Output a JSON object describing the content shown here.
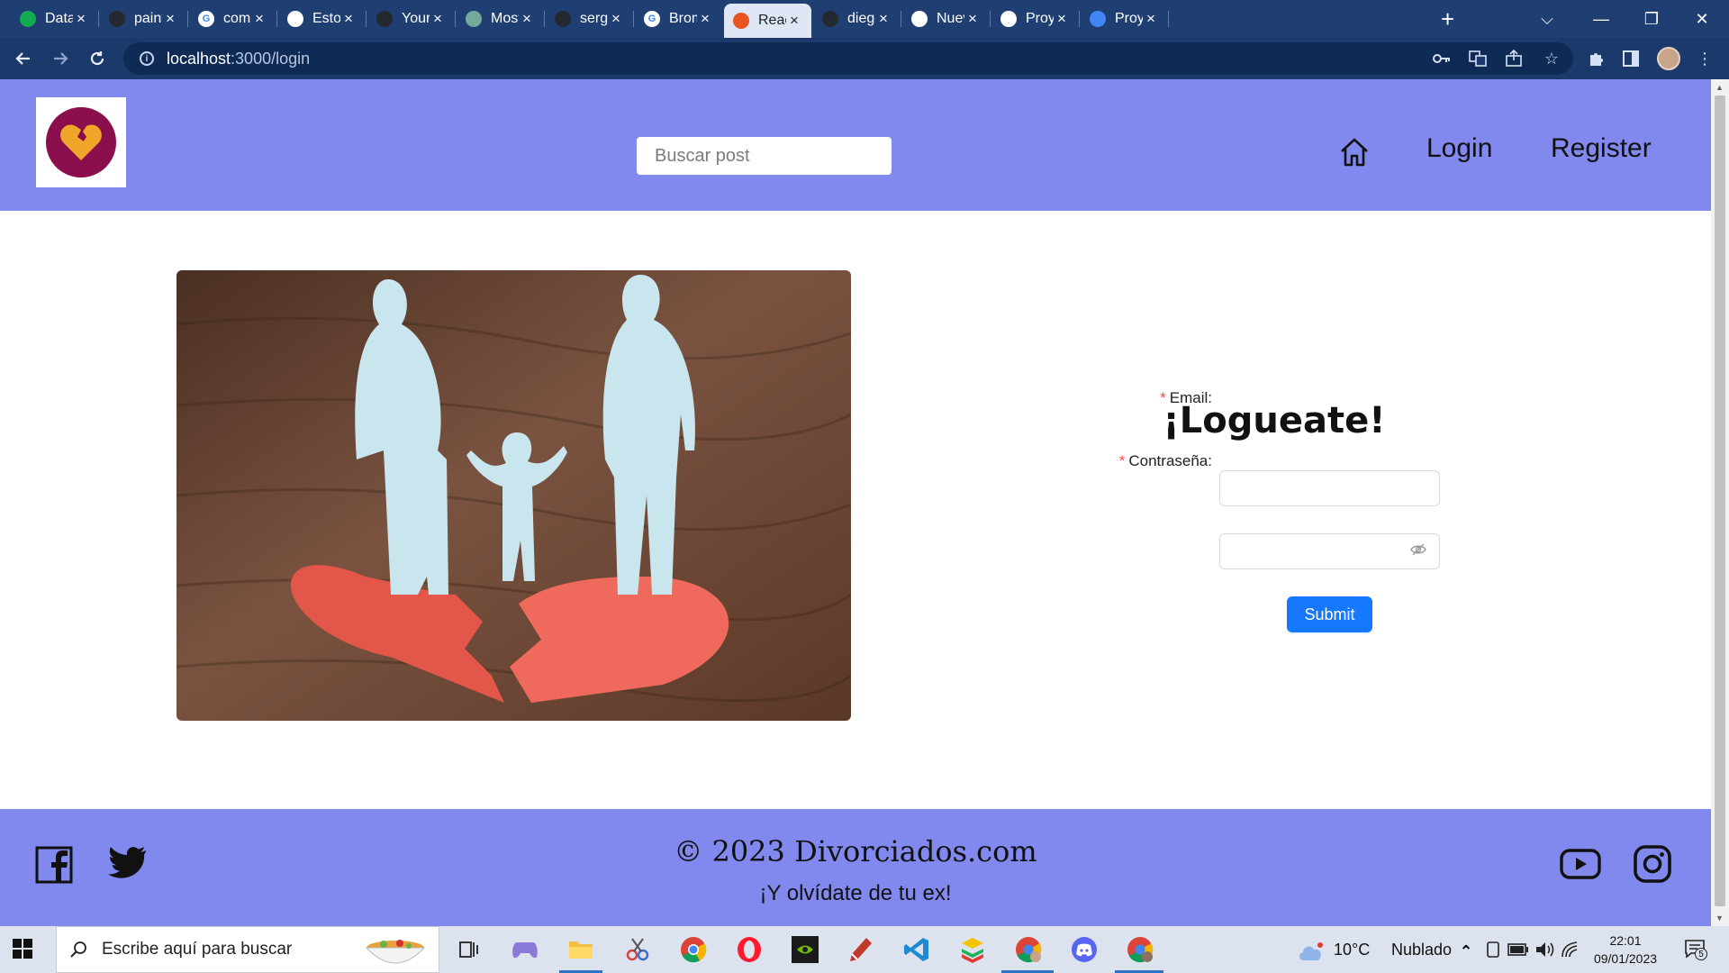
{
  "browser": {
    "tabs": [
      {
        "title": "Data |",
        "icon": "mongodb-leaf-icon",
        "color": "#13aa52"
      },
      {
        "title": "paintin",
        "icon": "github-icon",
        "color": "#24292f"
      },
      {
        "title": "comen",
        "icon": "google-icon",
        "color": "#ffffff"
      },
      {
        "title": "Estos",
        "icon": "skull-icon",
        "color": "#ffffff"
      },
      {
        "title": "Your R",
        "icon": "github-icon",
        "color": "#24292f"
      },
      {
        "title": "Mostr",
        "icon": "chatgpt-icon",
        "color": "#74aa9c"
      },
      {
        "title": "sergio",
        "icon": "github-icon",
        "color": "#24292f"
      },
      {
        "title": "Broma",
        "icon": "google-icon",
        "color": "#ffffff"
      },
      {
        "title": "React",
        "icon": "react-icon",
        "color": "#e95420"
      },
      {
        "title": "diegoj",
        "icon": "github-icon",
        "color": "#24292f"
      },
      {
        "title": "Nueva",
        "icon": "chrome-icon",
        "color": "#ffffff"
      },
      {
        "title": "Proyec",
        "icon": "contact-icon",
        "color": "#ffffff"
      },
      {
        "title": "Proyec",
        "icon": "docs-icon",
        "color": "#4285f4"
      }
    ],
    "active_tab_index": 8,
    "url_host": "localhost",
    "url_path": ":3000/login"
  },
  "site": {
    "search_placeholder": "Buscar post",
    "nav": {
      "login": "Login",
      "register": "Register"
    },
    "login": {
      "title": "¡Logueate!",
      "email_label": "Email",
      "password_label": "Contraseña",
      "required_mark": "*",
      "colon": ":",
      "submit": "Submit"
    },
    "footer": {
      "title": "© 2023 Divorciados.com",
      "subtitle": "¡Y olvídate de tu ex!"
    },
    "colors": {
      "header": "#8188ee",
      "submit": "#1677ff",
      "logo": "#8b0f4c",
      "heart": "#f0a62a"
    }
  },
  "taskbar": {
    "search_placeholder": "Escribe aquí para buscar",
    "weather_temp": "10°C",
    "weather_text": "Nublado",
    "time": "22:01",
    "date": "09/01/2023",
    "notification_count": "5"
  }
}
